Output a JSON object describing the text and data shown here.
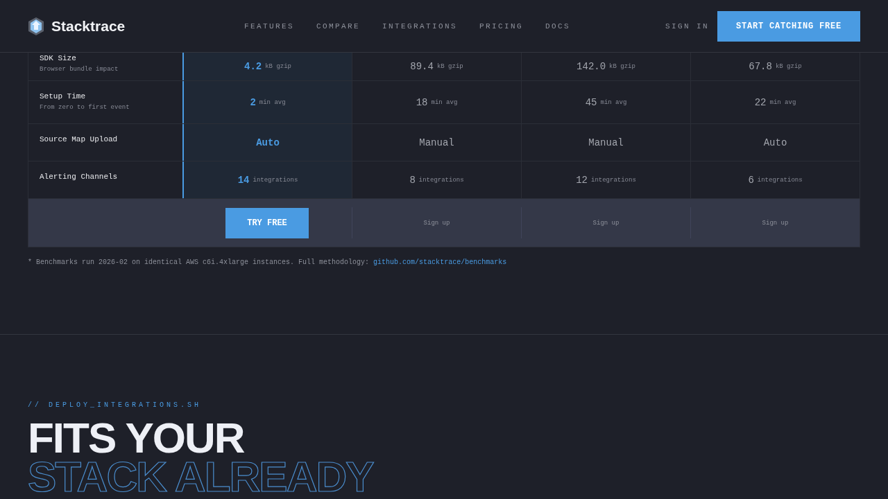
{
  "header": {
    "brand": "Stacktrace",
    "nav": [
      "FEATURES",
      "COMPARE",
      "INTEGRATIONS",
      "PRICING",
      "DOCS"
    ],
    "sign_in": "SIGN IN",
    "cta": "START CATCHING FREE"
  },
  "comparison": {
    "columns": [
      {
        "featured": true
      },
      {
        "featured": false
      },
      {
        "featured": false
      },
      {
        "featured": false
      }
    ],
    "rows": [
      {
        "label": "SDK Size",
        "sublabel": "Browser bundle impact",
        "cells": [
          {
            "value": "4.2",
            "unit": "kB gzip"
          },
          {
            "value": "89.4",
            "unit": "kB gzip"
          },
          {
            "value": "142.0",
            "unit": "kB gzip"
          },
          {
            "value": "67.8",
            "unit": "kB gzip"
          }
        ]
      },
      {
        "label": "Setup Time",
        "sublabel": "From zero to first event",
        "cells": [
          {
            "value": "2",
            "unit": "min avg"
          },
          {
            "value": "18",
            "unit": "min avg"
          },
          {
            "value": "45",
            "unit": "min avg"
          },
          {
            "value": "22",
            "unit": "min avg"
          }
        ]
      },
      {
        "label": "Source Map Upload",
        "cells": [
          {
            "value": "Auto"
          },
          {
            "value": "Manual"
          },
          {
            "value": "Manual"
          },
          {
            "value": "Auto"
          }
        ]
      },
      {
        "label": "Alerting Channels",
        "cells": [
          {
            "value": "14",
            "unit": "integrations"
          },
          {
            "value": "8",
            "unit": "integrations"
          },
          {
            "value": "12",
            "unit": "integrations"
          },
          {
            "value": "6",
            "unit": "integrations"
          }
        ]
      }
    ],
    "actions": [
      {
        "kind": "primary",
        "label": "TRY FREE"
      },
      {
        "kind": "link",
        "label": "Sign up"
      },
      {
        "kind": "link",
        "label": "Sign up"
      },
      {
        "kind": "link",
        "label": "Sign up"
      }
    ],
    "footnote": "* Benchmarks run 2026-02 on identical AWS c6i.4xlarge instances. Full methodology:",
    "footnote_link": "github.com/stacktrace/benchmarks"
  },
  "section": {
    "eyebrow": "// DEPLOY_INTEGRATIONS.SH",
    "title_line1": "FITS YOUR",
    "title_line2": "STACK ALREADY"
  }
}
